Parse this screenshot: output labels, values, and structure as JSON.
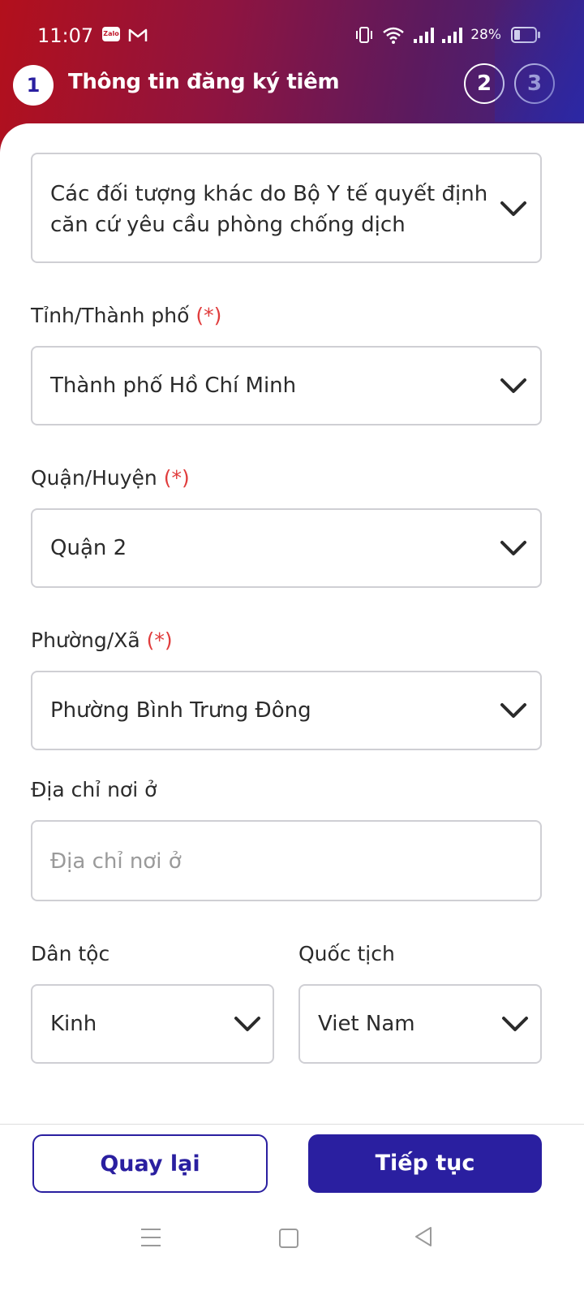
{
  "status": {
    "time": "11:07",
    "battery": "28%",
    "zalo_badge": "Zalo"
  },
  "header": {
    "current_step": "1",
    "title": "Thông tin đăng ký tiêm",
    "steps": [
      "2",
      "3"
    ]
  },
  "form": {
    "object_group_value": "Các đối tượng khác do Bộ Y tế quyết định căn cứ yêu cầu phòng chống dịch",
    "province_label": "Tỉnh/Thành phố",
    "province_value": "Thành phố Hồ Chí Minh",
    "district_label": "Quận/Huyện",
    "district_value": "Quận 2",
    "ward_label": "Phường/Xã",
    "ward_value": "Phường Bình Trưng Đông",
    "address_label": "Địa chỉ nơi ở",
    "address_placeholder": "Địa chỉ nơi ở",
    "ethnicity_label": "Dân tộc",
    "ethnicity_value": "Kinh",
    "nationality_label": "Quốc tịch",
    "nationality_value": "Viet Nam",
    "required_mark": "(*)"
  },
  "footer": {
    "back_label": "Quay lại",
    "next_label": "Tiếp tục"
  },
  "colors": {
    "primary": "#2a1fa0",
    "required": "#e03c3c",
    "header_start": "#b3101c",
    "header_end": "#3a2487"
  }
}
